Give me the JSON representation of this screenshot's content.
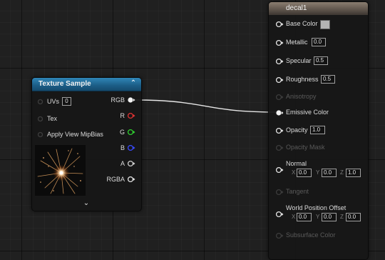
{
  "texture_sample": {
    "title": "Texture Sample",
    "collapse_glyph": "⌃",
    "expand_glyph": "⌄",
    "inputs": {
      "uvs": "UVs",
      "uvs_value": "0",
      "tex": "Tex",
      "mip": "Apply View MipBias"
    },
    "outputs": {
      "rgb": "RGB",
      "r": "R",
      "g": "G",
      "b": "B",
      "a": "A",
      "rgba": "RGBA"
    },
    "colors": {
      "r": "#e23333",
      "g": "#2fd02f",
      "b": "#3a4cff",
      "header": "#2f86b8"
    }
  },
  "decal": {
    "title": "decal1",
    "pins": {
      "base_color": "Base Color",
      "metallic": "Metallic",
      "metallic_value": "0.0",
      "specular": "Specular",
      "specular_value": "0.5",
      "roughness": "Roughness",
      "roughness_value": "0.5",
      "anisotropy": "Anisotropy",
      "emissive": "Emissive Color",
      "opacity": "Opacity",
      "opacity_value": "1.0",
      "opacity_mask": "Opacity Mask",
      "normal": "Normal",
      "normal_x": "0.0",
      "normal_y": "0.0",
      "normal_z": "1.0",
      "tangent": "Tangent",
      "wpo": "World Position Offset",
      "wpo_x": "0.0",
      "wpo_y": "0.0",
      "wpo_z": "0.0",
      "subsurface": "Subsurface Color"
    },
    "axes": {
      "x": "X",
      "y": "Y",
      "z": "Z"
    },
    "base_color_swatch": "#b4b4b4"
  }
}
